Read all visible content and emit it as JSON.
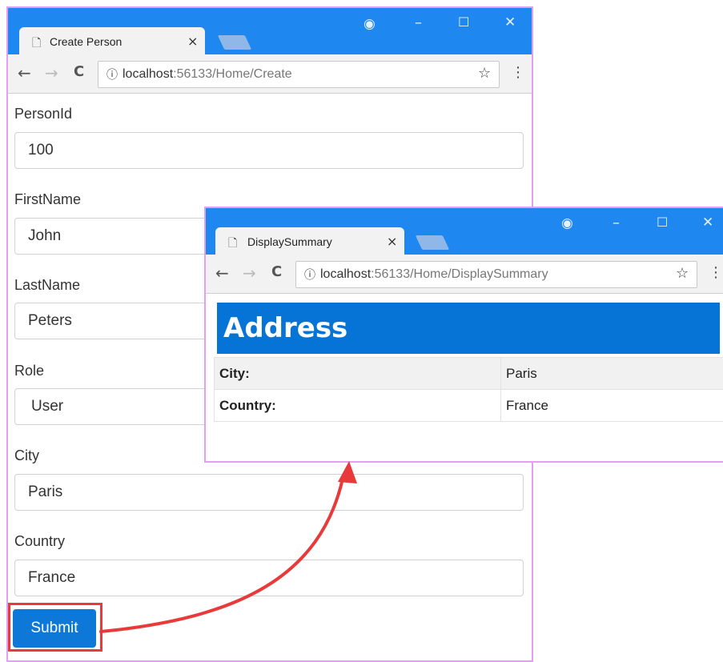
{
  "back_window": {
    "tab_title": "Create Person",
    "url_host": "localhost",
    "url_path": ":56133/Home/Create",
    "fields": [
      {
        "label": "PersonId",
        "value": "100"
      },
      {
        "label": "FirstName",
        "value": "John"
      },
      {
        "label": "LastName",
        "value": "Peters"
      },
      {
        "label": "Role",
        "value": "User"
      },
      {
        "label": "City",
        "value": "Paris"
      },
      {
        "label": "Country",
        "value": "France"
      }
    ],
    "submit_label": "Submit"
  },
  "front_window": {
    "tab_title": "DisplaySummary",
    "url_host": "localhost",
    "url_path": ":56133/Home/DisplaySummary",
    "heading": "Address",
    "rows": [
      {
        "key": "City:",
        "value": "Paris"
      },
      {
        "key": "Country:",
        "value": "France"
      }
    ]
  },
  "glyphs": {
    "minimize": "–",
    "maximize": "☐",
    "close": "✕",
    "back": "←",
    "forward": "→",
    "reload": "C",
    "info": "ⓘ",
    "star": "☆",
    "menu": "⋮",
    "doc": "🗋",
    "tab_close": "×",
    "account": "◉"
  },
  "colors": {
    "titlebar": "#1e88f0",
    "heading_bg": "#0674d6",
    "submit_bg": "#0e78d8",
    "arrow": "#e83a3a"
  }
}
